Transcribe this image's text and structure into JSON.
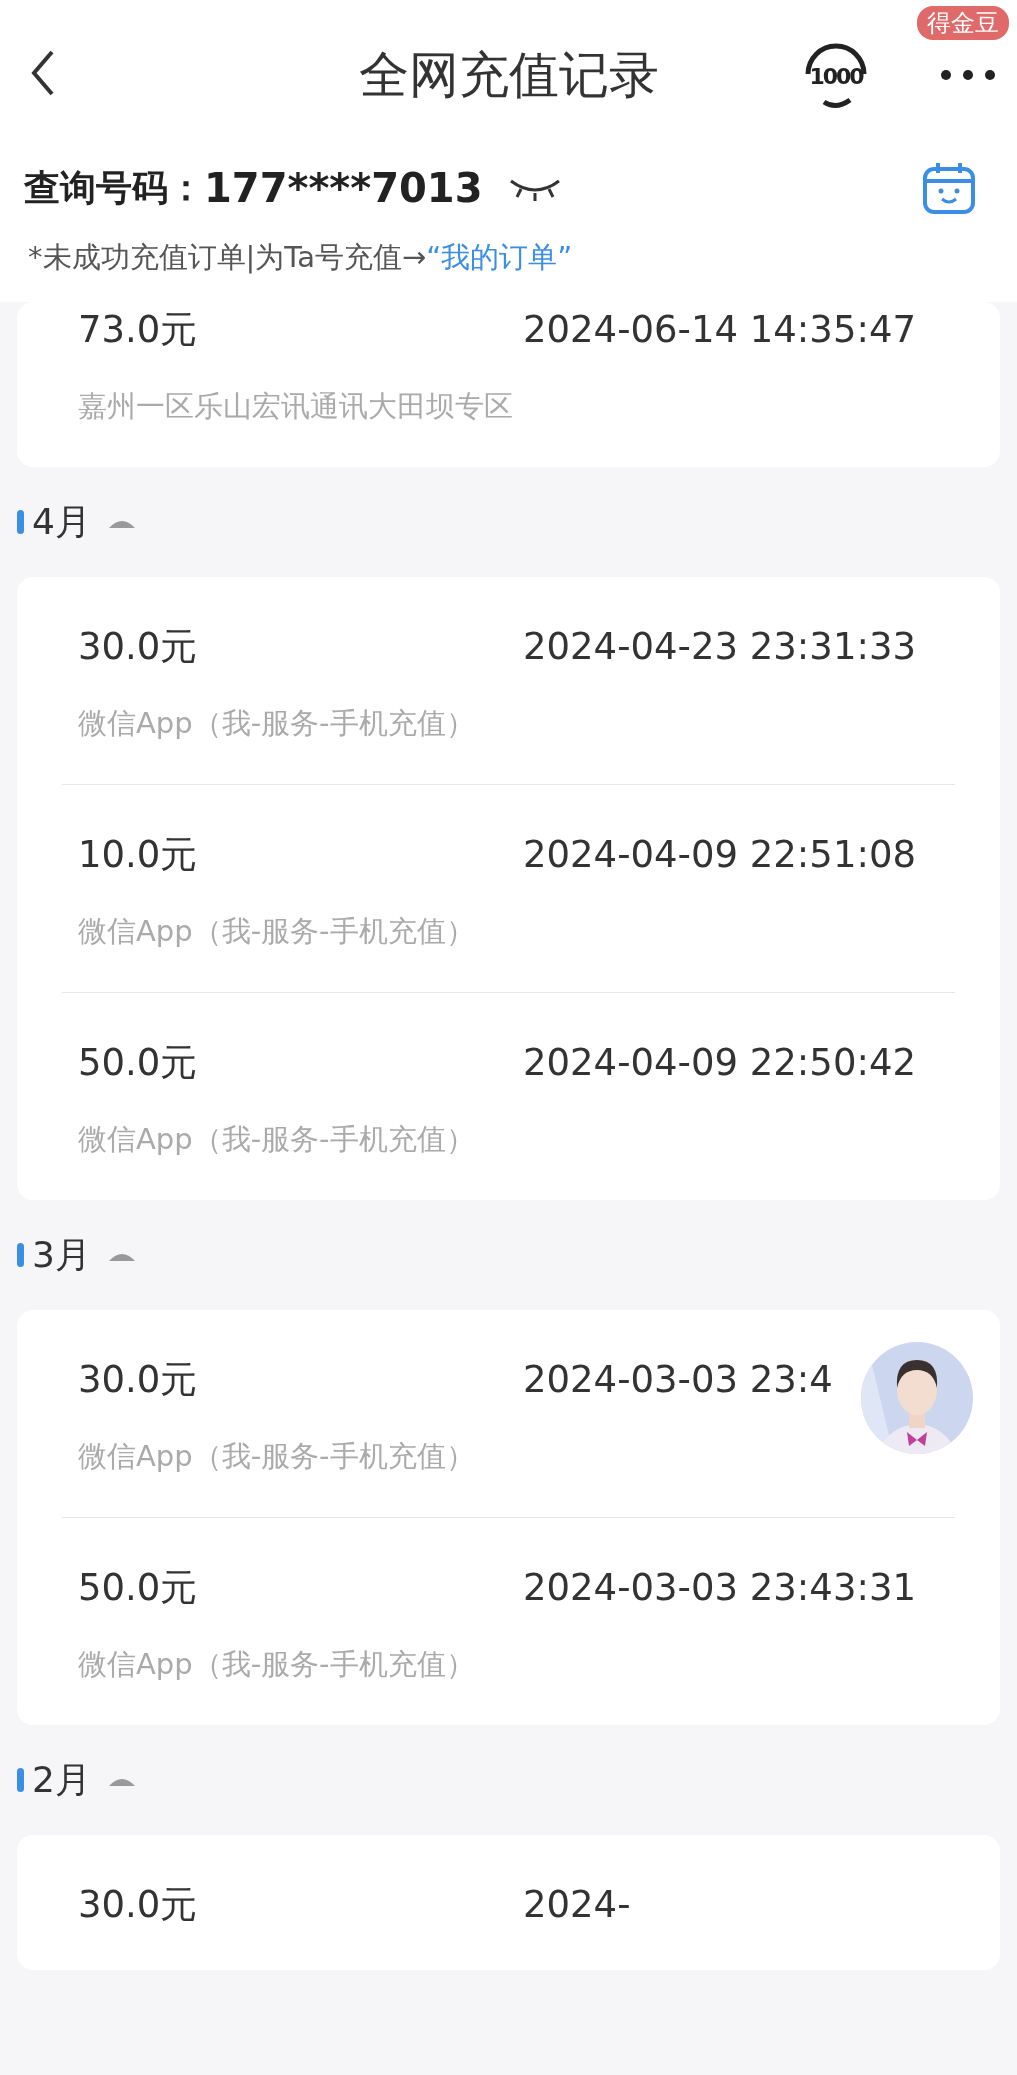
{
  "header": {
    "title": "全网充值记录",
    "hotline": "1000",
    "badge": "得金豆"
  },
  "query": {
    "label": "查询号码：",
    "number": "177****7013",
    "masked": true
  },
  "notice": {
    "text": "*未成功充值订单|为Ta号充值→",
    "link": "“我的订单”"
  },
  "groups": [
    {
      "records": [
        {
          "amount": "73.0元",
          "time": "2024-06-14 14:35:47",
          "source": "嘉州一区乐山宏讯通讯大田坝专区"
        }
      ]
    },
    {
      "month": "4月",
      "expanded": true,
      "records": [
        {
          "amount": "30.0元",
          "time": "2024-04-23 23:31:33",
          "source": "微信App（我-服务-手机充值）"
        },
        {
          "amount": "10.0元",
          "time": "2024-04-09 22:51:08",
          "source": "微信App（我-服务-手机充值）"
        },
        {
          "amount": "50.0元",
          "time": "2024-04-09 22:50:42",
          "source": "微信App（我-服务-手机充值）"
        }
      ]
    },
    {
      "month": "3月",
      "expanded": true,
      "records": [
        {
          "amount": "30.0元",
          "time": "2024-03-03 23:4",
          "source": "微信App（我-服务-手机充值）"
        },
        {
          "amount": "50.0元",
          "time": "2024-03-03 23:43:31",
          "source": "微信App（我-服务-手机充值）"
        }
      ]
    },
    {
      "month": "2月",
      "expanded": true,
      "records": [
        {
          "amount": "30.0元",
          "time": "2024-"
        }
      ]
    }
  ]
}
